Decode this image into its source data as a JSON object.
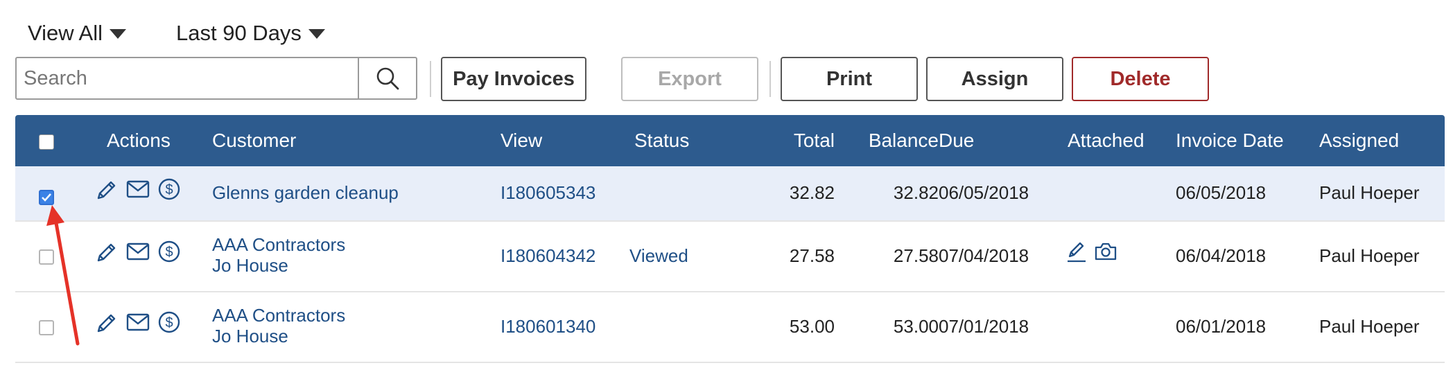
{
  "filters": {
    "view": "View All",
    "range": "Last 90 Days"
  },
  "search": {
    "placeholder": "Search"
  },
  "toolbar": {
    "pay_label": "Pay Invoices",
    "export_label": "Export",
    "print_label": "Print",
    "assign_label": "Assign",
    "delete_label": "Delete"
  },
  "colors": {
    "header_bg": "#2d5b8e",
    "selected_row": "#e8eef9",
    "link": "#1f4f86",
    "danger": "#a02a2a",
    "annotation_arrow": "#e53228"
  },
  "table": {
    "headers": {
      "actions": "Actions",
      "customer": "Customer",
      "view": "View",
      "status": "Status",
      "total": "Total",
      "balance": "Balance",
      "due": "Due",
      "attached": "Attached",
      "invoice_date": "Invoice Date",
      "assigned": "Assigned"
    },
    "rows": [
      {
        "checked": true,
        "customer": "Glenns garden cleanup",
        "contact": "",
        "invoice": "I180605343",
        "status": "",
        "total": "32.82",
        "balance": "32.82",
        "due": "06/05/2018",
        "attachments": [],
        "invoice_date": "06/05/2018",
        "assigned": "Paul Hoeper"
      },
      {
        "checked": false,
        "customer": "AAA Contractors",
        "contact": "Jo House",
        "invoice": "I180604342",
        "status": "Viewed",
        "total": "27.58",
        "balance": "27.58",
        "due": "07/04/2018",
        "attachments": [
          "signature-icon",
          "camera-icon"
        ],
        "invoice_date": "06/04/2018",
        "assigned": "Paul Hoeper"
      },
      {
        "checked": false,
        "customer": "AAA Contractors",
        "contact": "Jo House",
        "invoice": "I180601340",
        "status": "",
        "total": "53.00",
        "balance": "53.00",
        "due": "07/01/2018",
        "attachments": [],
        "invoice_date": "06/01/2018",
        "assigned": "Paul Hoeper"
      }
    ],
    "row_actions": [
      "edit-icon",
      "email-icon",
      "payment-icon"
    ]
  }
}
